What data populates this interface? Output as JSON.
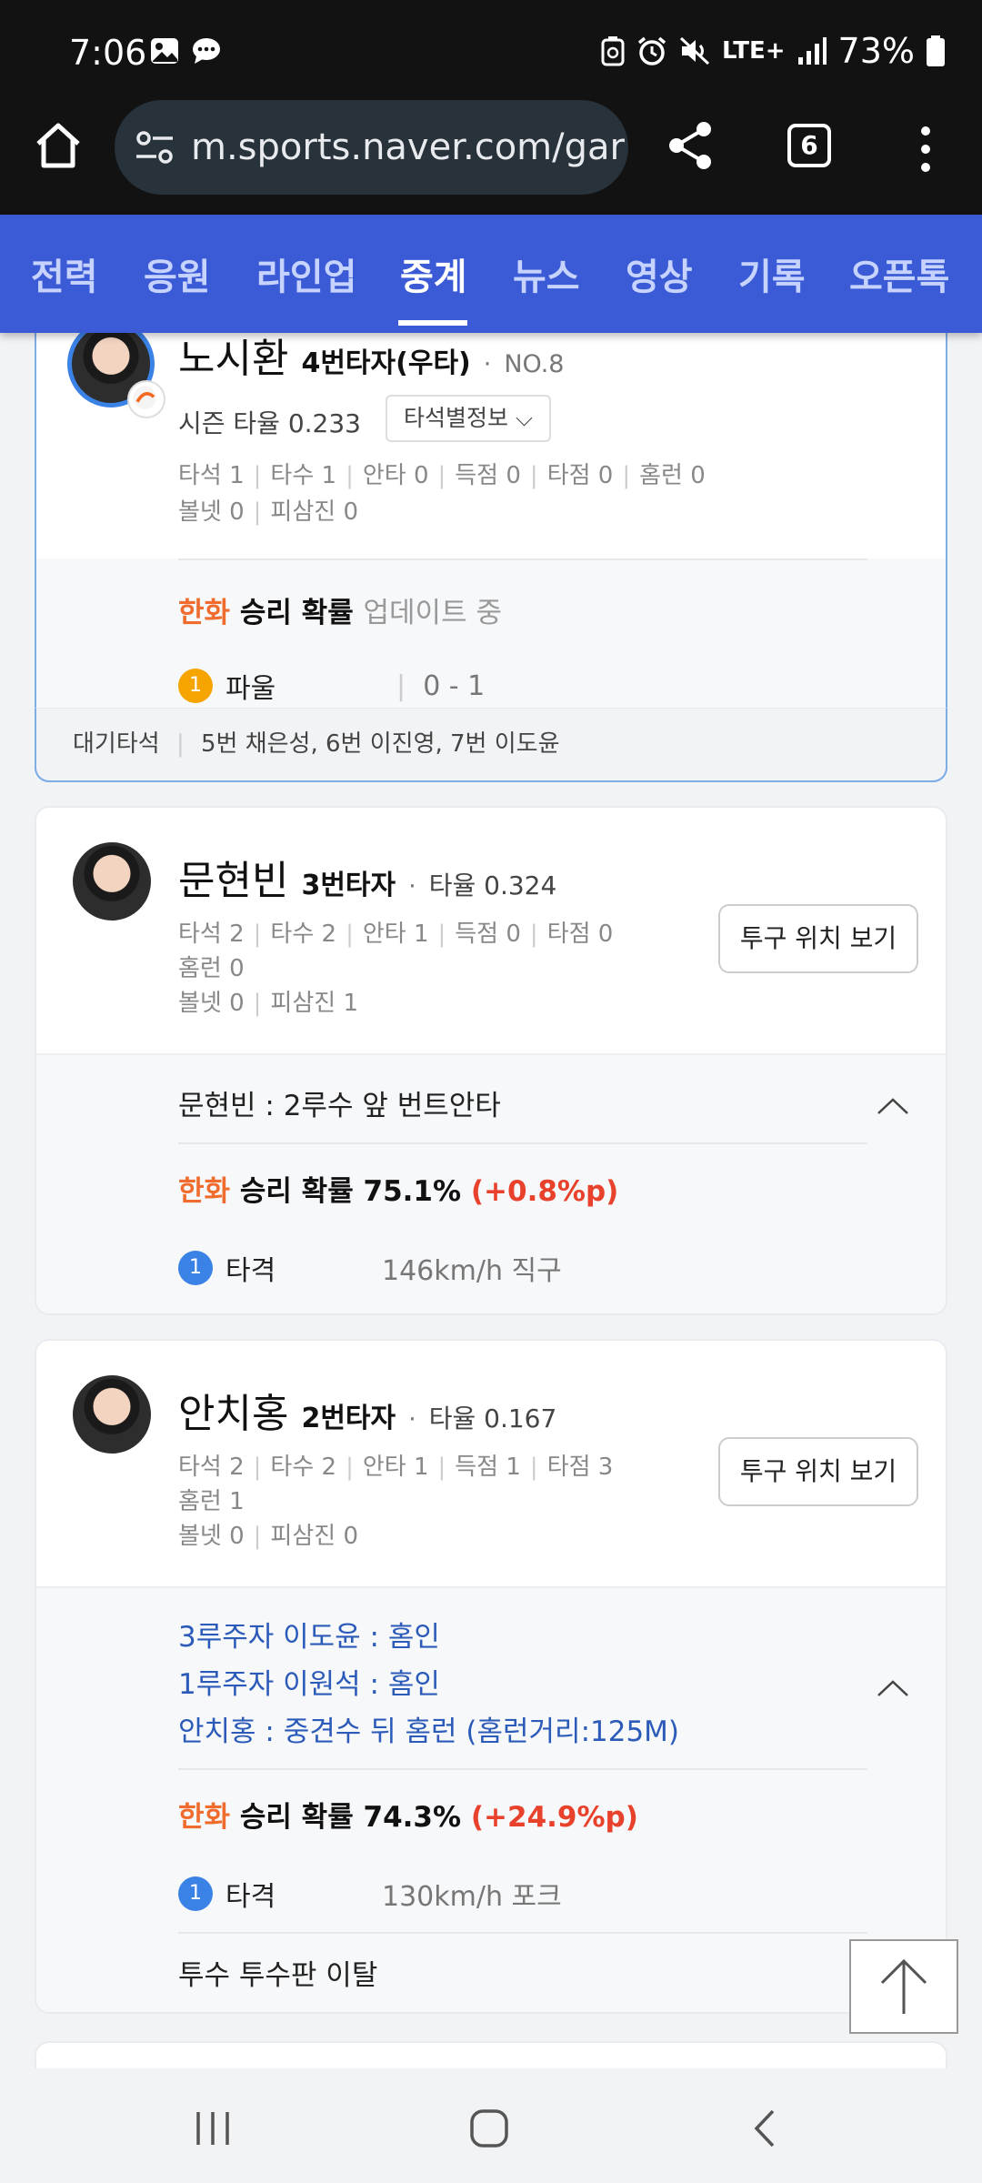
{
  "status": {
    "time": "7:06",
    "network": "LTE+",
    "battery": "73%"
  },
  "browser": {
    "url": "m.sports.naver.com/gar",
    "tab_count": "6"
  },
  "nav": {
    "items": [
      {
        "label": "전력",
        "active": false
      },
      {
        "label": "응원",
        "active": false
      },
      {
        "label": "라인업",
        "active": false
      },
      {
        "label": "중계",
        "active": true
      },
      {
        "label": "뉴스",
        "active": false
      },
      {
        "label": "영상",
        "active": false
      },
      {
        "label": "기록",
        "active": false
      },
      {
        "label": "오픈톡",
        "active": false
      }
    ]
  },
  "current_batter": {
    "name": "노시환",
    "order": "4번타자(우타)",
    "number": "NO.8",
    "season_avg": "시즌 타율 0.233",
    "detail_button": "타석별정보",
    "stats_line1": [
      "타석 1",
      "타수 1",
      "안타 0",
      "득점 0",
      "타점 0",
      "홈런 0"
    ],
    "stats_line2": [
      "볼넷 0",
      "피삼진 0"
    ],
    "win_team": "한화",
    "win_label": "승리 확률",
    "win_status": "업데이트 중",
    "pitch_num": "1",
    "pitch_result": "파울",
    "pitch_count": "0 - 1",
    "waiting_label": "대기타석",
    "waiting_list": "5번 채은성, 6번 이진영, 7번 이도윤"
  },
  "card2": {
    "name": "문현빈",
    "order": "3번타자",
    "avg": "타율 0.324",
    "stats_line1": [
      "타석 2",
      "타수 2",
      "안타 1",
      "득점 0",
      "타점 0"
    ],
    "stats_line2": [
      "홈런 0"
    ],
    "stats_line3": [
      "볼넷 0",
      "피삼진 1"
    ],
    "pitch_button": "투구 위치 보기",
    "event": "문현빈 : 2루수 앞 번트안타",
    "win_team": "한화",
    "win_label": "승리 확률 75.1%",
    "win_delta": "(+0.8%p)",
    "pitch_num": "1",
    "pitch_result": "타격",
    "pitch_meta": "146km/h  직구"
  },
  "card3": {
    "name": "안치홍",
    "order": "2번타자",
    "avg": "타율 0.167",
    "stats_line1": [
      "타석 2",
      "타수 2",
      "안타 1",
      "득점 1",
      "타점 3"
    ],
    "stats_line2": [
      "홈런 1"
    ],
    "stats_line3": [
      "볼넷 0",
      "피삼진 0"
    ],
    "pitch_button": "투구 위치 보기",
    "events": [
      "3루주자 이도윤 : 홈인",
      "1루주자 이원석 : 홈인",
      "안치홍 : 중견수 뒤 홈런 (홈런거리:125M)"
    ],
    "win_team": "한화",
    "win_label": "승리 확률 74.3%",
    "win_delta": "(+24.9%p)",
    "pitch_num": "1",
    "pitch_result": "타격",
    "pitch_meta": "130km/h  포크",
    "footer": "투수 투수판 이탈"
  },
  "colors": {
    "nav_bg": "#3b5bd6",
    "team_orange": "#ef6c2e",
    "delta_red": "#e8412c",
    "event_blue": "#2b5ab8",
    "foul_badge": "#f5a400",
    "hit_badge": "#3b82e6"
  }
}
